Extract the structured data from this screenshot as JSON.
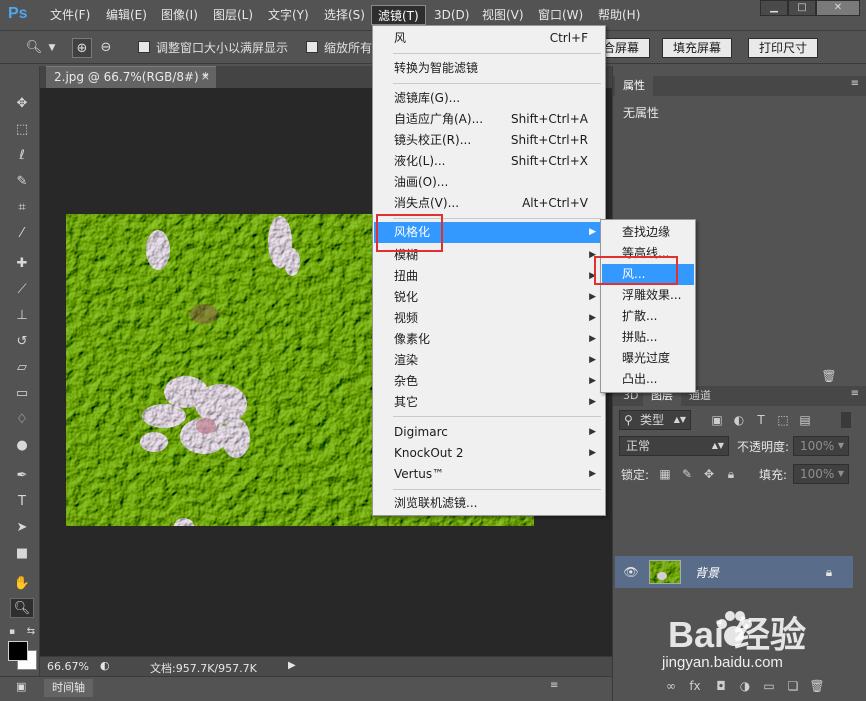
{
  "app": {
    "logo": "Ps"
  },
  "menubar": {
    "items": [
      {
        "label": "文件(F)"
      },
      {
        "label": "编辑(E)"
      },
      {
        "label": "图像(I)"
      },
      {
        "label": "图层(L)"
      },
      {
        "label": "文字(Y)"
      },
      {
        "label": "选择(S)"
      },
      {
        "label": "滤镜(T)"
      },
      {
        "label": "3D(D)"
      },
      {
        "label": "视图(V)"
      },
      {
        "label": "窗口(W)"
      },
      {
        "label": "帮助(H)"
      }
    ],
    "active_index": 6,
    "window_controls": {
      "minimize": "▁",
      "maximize": "□",
      "close": "✕"
    }
  },
  "options_bar": {
    "checkbox_resize_label": "调整窗口大小以满屏显示",
    "checkbox_zoom_all_label": "缩放所有",
    "fit_screen_label": "合屏幕",
    "fill_screen_label": "填充屏幕",
    "print_size_label": "打印尺寸"
  },
  "document": {
    "tab_title": "2.jpg @ 66.7%(RGB/8#) *",
    "tab_close": "×",
    "zoom": "66.67%",
    "doc_info": "文档:957.7K/957.7K"
  },
  "timeline": {
    "tab_label": "时间轴"
  },
  "filter_menu": {
    "items": [
      {
        "label": "风",
        "shortcut": "Ctrl+F"
      },
      {
        "label": "转换为智能滤镜",
        "shortcut": ""
      },
      {
        "label": "滤镜库(G)...",
        "shortcut": ""
      },
      {
        "label": "自适应广角(A)...",
        "shortcut": "Shift+Ctrl+A"
      },
      {
        "label": "镜头校正(R)...",
        "shortcut": "Shift+Ctrl+R"
      },
      {
        "label": "液化(L)...",
        "shortcut": "Shift+Ctrl+X"
      },
      {
        "label": "油画(O)...",
        "shortcut": ""
      },
      {
        "label": "消失点(V)...",
        "shortcut": "Alt+Ctrl+V"
      },
      {
        "label": "风格化",
        "shortcut": ""
      },
      {
        "label": "模糊",
        "shortcut": ""
      },
      {
        "label": "扭曲",
        "shortcut": ""
      },
      {
        "label": "锐化",
        "shortcut": ""
      },
      {
        "label": "视频",
        "shortcut": ""
      },
      {
        "label": "像素化",
        "shortcut": ""
      },
      {
        "label": "渲染",
        "shortcut": ""
      },
      {
        "label": "杂色",
        "shortcut": ""
      },
      {
        "label": "其它",
        "shortcut": ""
      },
      {
        "label": "Digimarc",
        "shortcut": ""
      },
      {
        "label": "KnockOut 2",
        "shortcut": ""
      },
      {
        "label": "Vertus™",
        "shortcut": ""
      },
      {
        "label": "浏览联机滤镜...",
        "shortcut": ""
      }
    ],
    "highlighted": "风格化"
  },
  "stylize_submenu": {
    "items": [
      {
        "label": "查找边缘"
      },
      {
        "label": "等高线..."
      },
      {
        "label": "风..."
      },
      {
        "label": "浮雕效果..."
      },
      {
        "label": "扩散..."
      },
      {
        "label": "拼贴..."
      },
      {
        "label": "曝光过度"
      },
      {
        "label": "凸出..."
      }
    ],
    "highlighted": "风..."
  },
  "properties_panel": {
    "tab_label": "属性",
    "empty_text": "无属性"
  },
  "layers_panel": {
    "tabs": [
      {
        "label": "3D"
      },
      {
        "label": "图层"
      },
      {
        "label": "通道"
      }
    ],
    "active_tab": "图层",
    "filter_kind": "类型",
    "blend_mode": "正常",
    "opacity_label": "不透明度:",
    "opacity_value": "100%",
    "lock_label": "锁定:",
    "fill_label": "填充:",
    "fill_value": "100%",
    "layer_name": "背景"
  },
  "watermark": {
    "logo_text": "Bai  经验",
    "url": "jingyan.baidu.com"
  },
  "colors": {
    "highlight": "#3399ff",
    "annotation_red": "#e03030",
    "selected_layer": "#596c89",
    "ps_logo": "#4fa6f0"
  }
}
